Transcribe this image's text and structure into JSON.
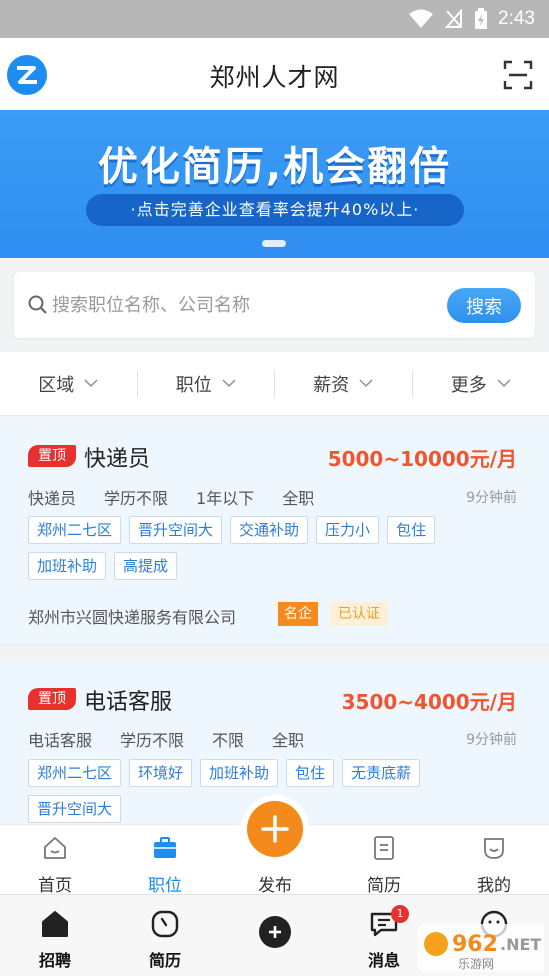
{
  "status_bar": {
    "time": "2:43"
  },
  "header": {
    "title": "郑州人才网"
  },
  "banner": {
    "title": "优化简历,机会翻倍",
    "subtitle": "·点击完善企业查看率会提升40%以上·"
  },
  "search": {
    "placeholder": "搜索职位名称、公司名称",
    "button": "搜索"
  },
  "filters": [
    {
      "label": "区域"
    },
    {
      "label": "职位"
    },
    {
      "label": "薪资"
    },
    {
      "label": "更多"
    }
  ],
  "jobs": [
    {
      "badge": "置顶",
      "title": "快递员",
      "salary": "5000~10000元/月",
      "meta": [
        "快递员",
        "学历不限",
        "1年以下",
        "全职"
      ],
      "time": "9分钟前",
      "tags_row1": [
        "郑州二七区",
        "晋升空间大",
        "交通补助",
        "压力小",
        "包住"
      ],
      "tags_row2": [
        "加班补助",
        "高提成"
      ],
      "company": "郑州市兴圆快递服务有限公司",
      "company_badge": "名企",
      "verified_badge": "已认证"
    },
    {
      "badge": "置顶",
      "title": "电话客服",
      "salary": "3500~4000元/月",
      "meta": [
        "电话客服",
        "学历不限",
        "不限",
        "全职"
      ],
      "time": "9分钟前",
      "tags_row1": [
        "郑州二七区",
        "环境好",
        "加班补助",
        "包住",
        "无责底薪"
      ],
      "tags_row2": [
        "晋升空间大"
      ]
    }
  ],
  "tabbar": [
    {
      "label": "首页",
      "icon": "home-icon"
    },
    {
      "label": "职位",
      "icon": "briefcase-icon"
    },
    {
      "label": "发布",
      "icon": "plus-icon"
    },
    {
      "label": "简历",
      "icon": "document-icon"
    },
    {
      "label": "我的",
      "icon": "smile-icon"
    }
  ],
  "bottom_nav": [
    {
      "label": "招聘",
      "icon": "house-icon"
    },
    {
      "label": "简历",
      "icon": "clock-icon"
    },
    {
      "label": "",
      "icon": "plus-circle-icon"
    },
    {
      "label": "消息",
      "icon": "chat-icon",
      "badge": "1"
    }
  ],
  "colors": {
    "accent": "#1d8ef0",
    "salary": "#f0552f",
    "publish": "#f58a1c",
    "pin": "#e8312e"
  }
}
